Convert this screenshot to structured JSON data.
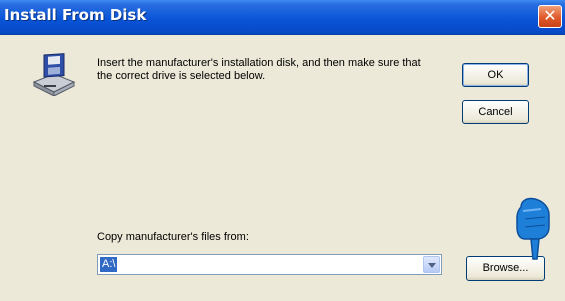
{
  "window": {
    "title": "Install From Disk",
    "close_glyph": "✕"
  },
  "dialog": {
    "message": "Insert the manufacturer's installation disk, and then make sure that the correct drive is selected below.",
    "icon": "floppy-disk-drive-icon",
    "buttons": {
      "ok": "OK",
      "cancel": "Cancel",
      "browse": "Browse..."
    },
    "copy_from_label": "Copy manufacturer's files from:",
    "copy_from_value": "A:\\"
  },
  "colors": {
    "titlebar": "#0a55d8",
    "close": "#e05a2a",
    "face": "#ece9d8",
    "selection": "#316ac5",
    "pointer": "#1e7fd8"
  }
}
